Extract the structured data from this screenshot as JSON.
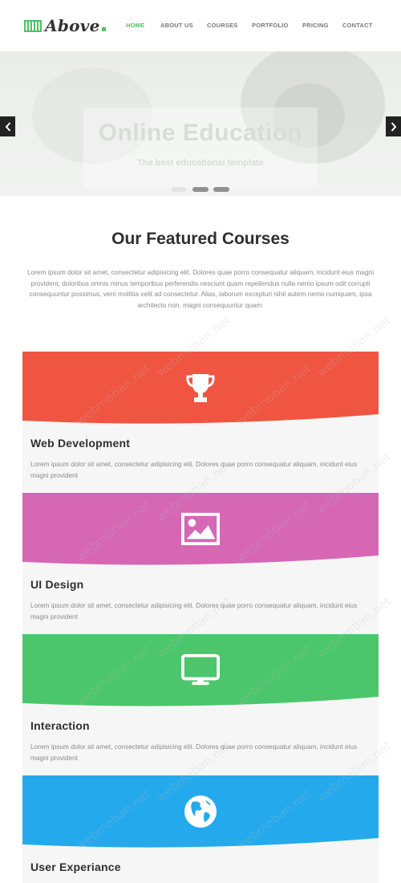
{
  "header": {
    "logo_text": "Above",
    "nav": [
      {
        "label": "HOME",
        "active": true
      },
      {
        "label": "ABOUT US",
        "active": false
      },
      {
        "label": "COURSES",
        "active": false
      },
      {
        "label": "PORTFOLIO",
        "active": false
      },
      {
        "label": "PRICING",
        "active": false
      },
      {
        "label": "CONTACT",
        "active": false
      }
    ]
  },
  "hero": {
    "title": "Online Education",
    "subtitle": "The best educational template",
    "prev_icon": "chevron-left-icon",
    "next_icon": "chevron-right-icon",
    "slides": 3,
    "active_slide": 1
  },
  "featured": {
    "title": "Our Featured Courses",
    "text": "Lorem ipsum dolor sit amet, consectetur adipisicing elit. Dolores quae porro consequatur aliquam, incidunt eius magni provident, doloribus omnis minus temporibus perferendis nesciunt quam repellendus nulla nemo ipsum odit corrupti consequuntur possimus, vero mollitia velit ad consectetur. Alias, laborum excepturi nihil autem nemo numquam, ipsa architecto non, magni consequuntur quam."
  },
  "courses": [
    {
      "title": "Web Development",
      "text": "Lorem ipsum dolor sit amet, consectetur adipisicing elit. Dolores quae porro consequatur aliquam, incidunt eius magni provident",
      "icon": "trophy-icon",
      "color": "#f05541"
    },
    {
      "title": "UI Design",
      "text": "Lorem ipsum dolor sit amet, consectetur adipisicing elit. Dolores quae porro consequatur aliquam, incidunt eius magni provident",
      "icon": "image-icon",
      "color": "#d567b5"
    },
    {
      "title": "Interaction",
      "text": "Lorem ipsum dolor sit amet, consectetur adipisicing elit. Dolores quae porro consequatur aliquam, incidunt eius magni provident",
      "icon": "monitor-icon",
      "color": "#4cc66c"
    },
    {
      "title": "User Experiance",
      "text": "",
      "icon": "globe-icon",
      "color": "#25a9ed"
    }
  ],
  "colors": {
    "accent": "#49c464",
    "title_text": "#2f2f2f",
    "body_text": "#8a8a8a"
  },
  "watermark": "webmoban.net"
}
